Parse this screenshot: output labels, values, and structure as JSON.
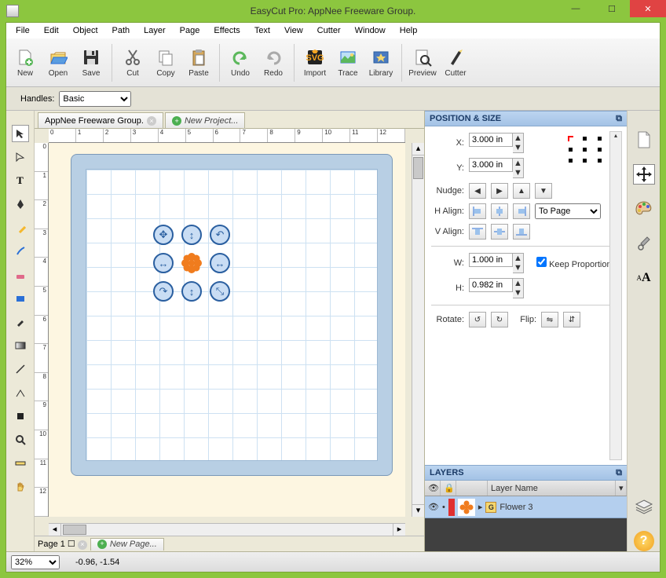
{
  "window": {
    "title": "EasyCut Pro: AppNee Freeware Group."
  },
  "menu": [
    "File",
    "Edit",
    "Object",
    "Path",
    "Layer",
    "Page",
    "Effects",
    "Text",
    "View",
    "Cutter",
    "Window",
    "Help"
  ],
  "toolbar": [
    {
      "id": "new",
      "label": "New"
    },
    {
      "id": "open",
      "label": "Open"
    },
    {
      "id": "save",
      "label": "Save"
    },
    {
      "id": "sep"
    },
    {
      "id": "cut",
      "label": "Cut"
    },
    {
      "id": "copy",
      "label": "Copy"
    },
    {
      "id": "paste",
      "label": "Paste"
    },
    {
      "id": "sep"
    },
    {
      "id": "undo",
      "label": "Undo"
    },
    {
      "id": "redo",
      "label": "Redo"
    },
    {
      "id": "sep"
    },
    {
      "id": "import",
      "label": "Import"
    },
    {
      "id": "trace",
      "label": "Trace"
    },
    {
      "id": "library",
      "label": "Library"
    },
    {
      "id": "sep"
    },
    {
      "id": "preview",
      "label": "Preview"
    },
    {
      "id": "cutter",
      "label": "Cutter"
    }
  ],
  "handles": {
    "label": "Handles:",
    "value": "Basic"
  },
  "tabs": {
    "tab1": "AppNee Freeware Group.",
    "tab2": "New Project..."
  },
  "ruler_h": [
    "0",
    "1",
    "2",
    "3",
    "4",
    "5",
    "6",
    "7",
    "8",
    "9",
    "10",
    "11",
    "12"
  ],
  "ruler_v": [
    "0",
    "1",
    "2",
    "3",
    "4",
    "5",
    "6",
    "7",
    "8",
    "9",
    "10",
    "11",
    "12"
  ],
  "pagebar": {
    "page_label": "Page 1",
    "newpage": "New Page..."
  },
  "pos_size": {
    "title": "POSITION & SIZE",
    "x_label": "X:",
    "x_value": "3.000 in",
    "y_label": "Y:",
    "y_value": "3.000 in",
    "nudge_label": "Nudge:",
    "halign_label": "H Align:",
    "valign_label": "V Align:",
    "align_to": "To Page",
    "w_label": "W:",
    "w_value": "1.000 in",
    "h_label": "H:",
    "h_value": "0.982 in",
    "keep_prop": "Keep Proportions",
    "rotate_label": "Rotate:",
    "flip_label": "Flip:"
  },
  "layers": {
    "title": "LAYERS",
    "header": "Layer Name",
    "item_name": "Flower 3",
    "group_badge": "G"
  },
  "status": {
    "zoom": "32%",
    "coords": "-0.96, -1.54"
  }
}
